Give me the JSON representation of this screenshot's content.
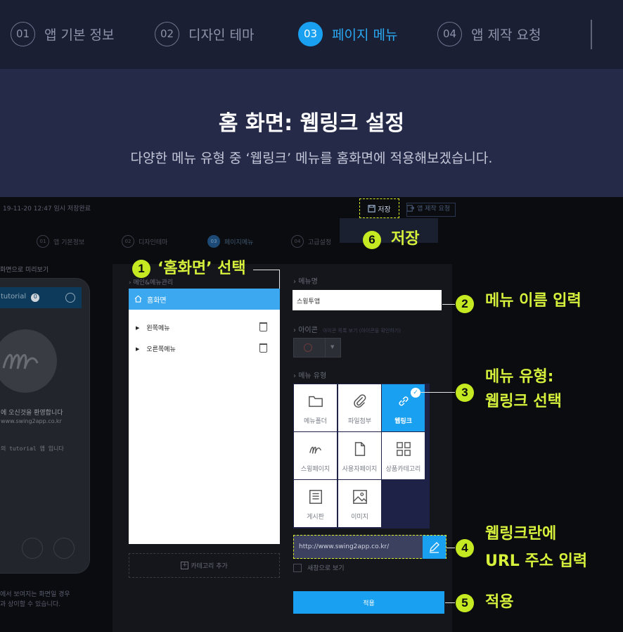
{
  "steps": [
    {
      "num": "01",
      "label": "앱 기본 정보"
    },
    {
      "num": "02",
      "label": "디자인 테마"
    },
    {
      "num": "03",
      "label": "페이지 메뉴"
    },
    {
      "num": "04",
      "label": "앱 제작 요청"
    }
  ],
  "hero": {
    "title": "홈 화면: 웹링크 설정",
    "subtitle": "다양한 메뉴 유형 중 ‘웹링크’ 메뉴를 홈화면에 적용해보겠습니다."
  },
  "shot": {
    "autosave": "19-11-20 12:47 임시 저장완료",
    "save_label": "저장",
    "request_label": "앱 제작 요청",
    "inner_steps": [
      {
        "num": "01",
        "label": "앱 기본정보"
      },
      {
        "num": "02",
        "label": "디자인테마"
      },
      {
        "num": "03",
        "label": "페이지메뉴"
      },
      {
        "num": "04",
        "label": "고급설정"
      }
    ],
    "preview_label": "화면으로 미리보기",
    "phone": {
      "app": "tutorial",
      "count": "0",
      "welcome": "에 오신것을 환영합니다",
      "site": "www.swing2app.co.kr",
      "note": "의 tutorial 앱 입니다"
    },
    "preview_note1": "에서 보여지는 화면일 경우",
    "preview_note2": "과 상이할 수 있습니다.",
    "menu_mgmt": "메인&메뉴관리",
    "home_label": "홈화면",
    "left_menu": "왼쪽메뉴",
    "right_menu": "오른쪽메뉴",
    "add_category": "카테고리 추가",
    "menu_name_label": "메뉴명",
    "menu_name_value": "스윙투앱",
    "icon_label": "아이콘",
    "icon_hint": "아이콘 목록 보기 (아이콘을 확인하기)",
    "menu_type_label": "메뉴 유형",
    "menu_types": [
      "메뉴폴더",
      "파일첨부",
      "웹링크",
      "스윙페이지",
      "사용자페이지",
      "상품카테고리",
      "게시판",
      "이미지"
    ],
    "url_value": "http://www.swing2app.co.kr/",
    "new_window": "새창으로 보기",
    "apply_label": "적용"
  },
  "callouts": {
    "c1": {
      "num": "1",
      "text": "‘홈화면’ 선택"
    },
    "c2": {
      "num": "2",
      "text": "메뉴 이름 입력"
    },
    "c3": {
      "num": "3",
      "line1": "메뉴 유형:",
      "line2": "웹링크 선택"
    },
    "c4": {
      "num": "4",
      "line1": "웹링크란에",
      "line2": "URL 주소 입력"
    },
    "c5": {
      "num": "5",
      "text": "적용"
    },
    "c6": {
      "num": "6",
      "text": "저장"
    }
  },
  "colors": {
    "accent": "#1aa0f0",
    "callout": "#c6ea22",
    "header_bg": "#1a1f33",
    "hero_bg": "#252a48"
  }
}
